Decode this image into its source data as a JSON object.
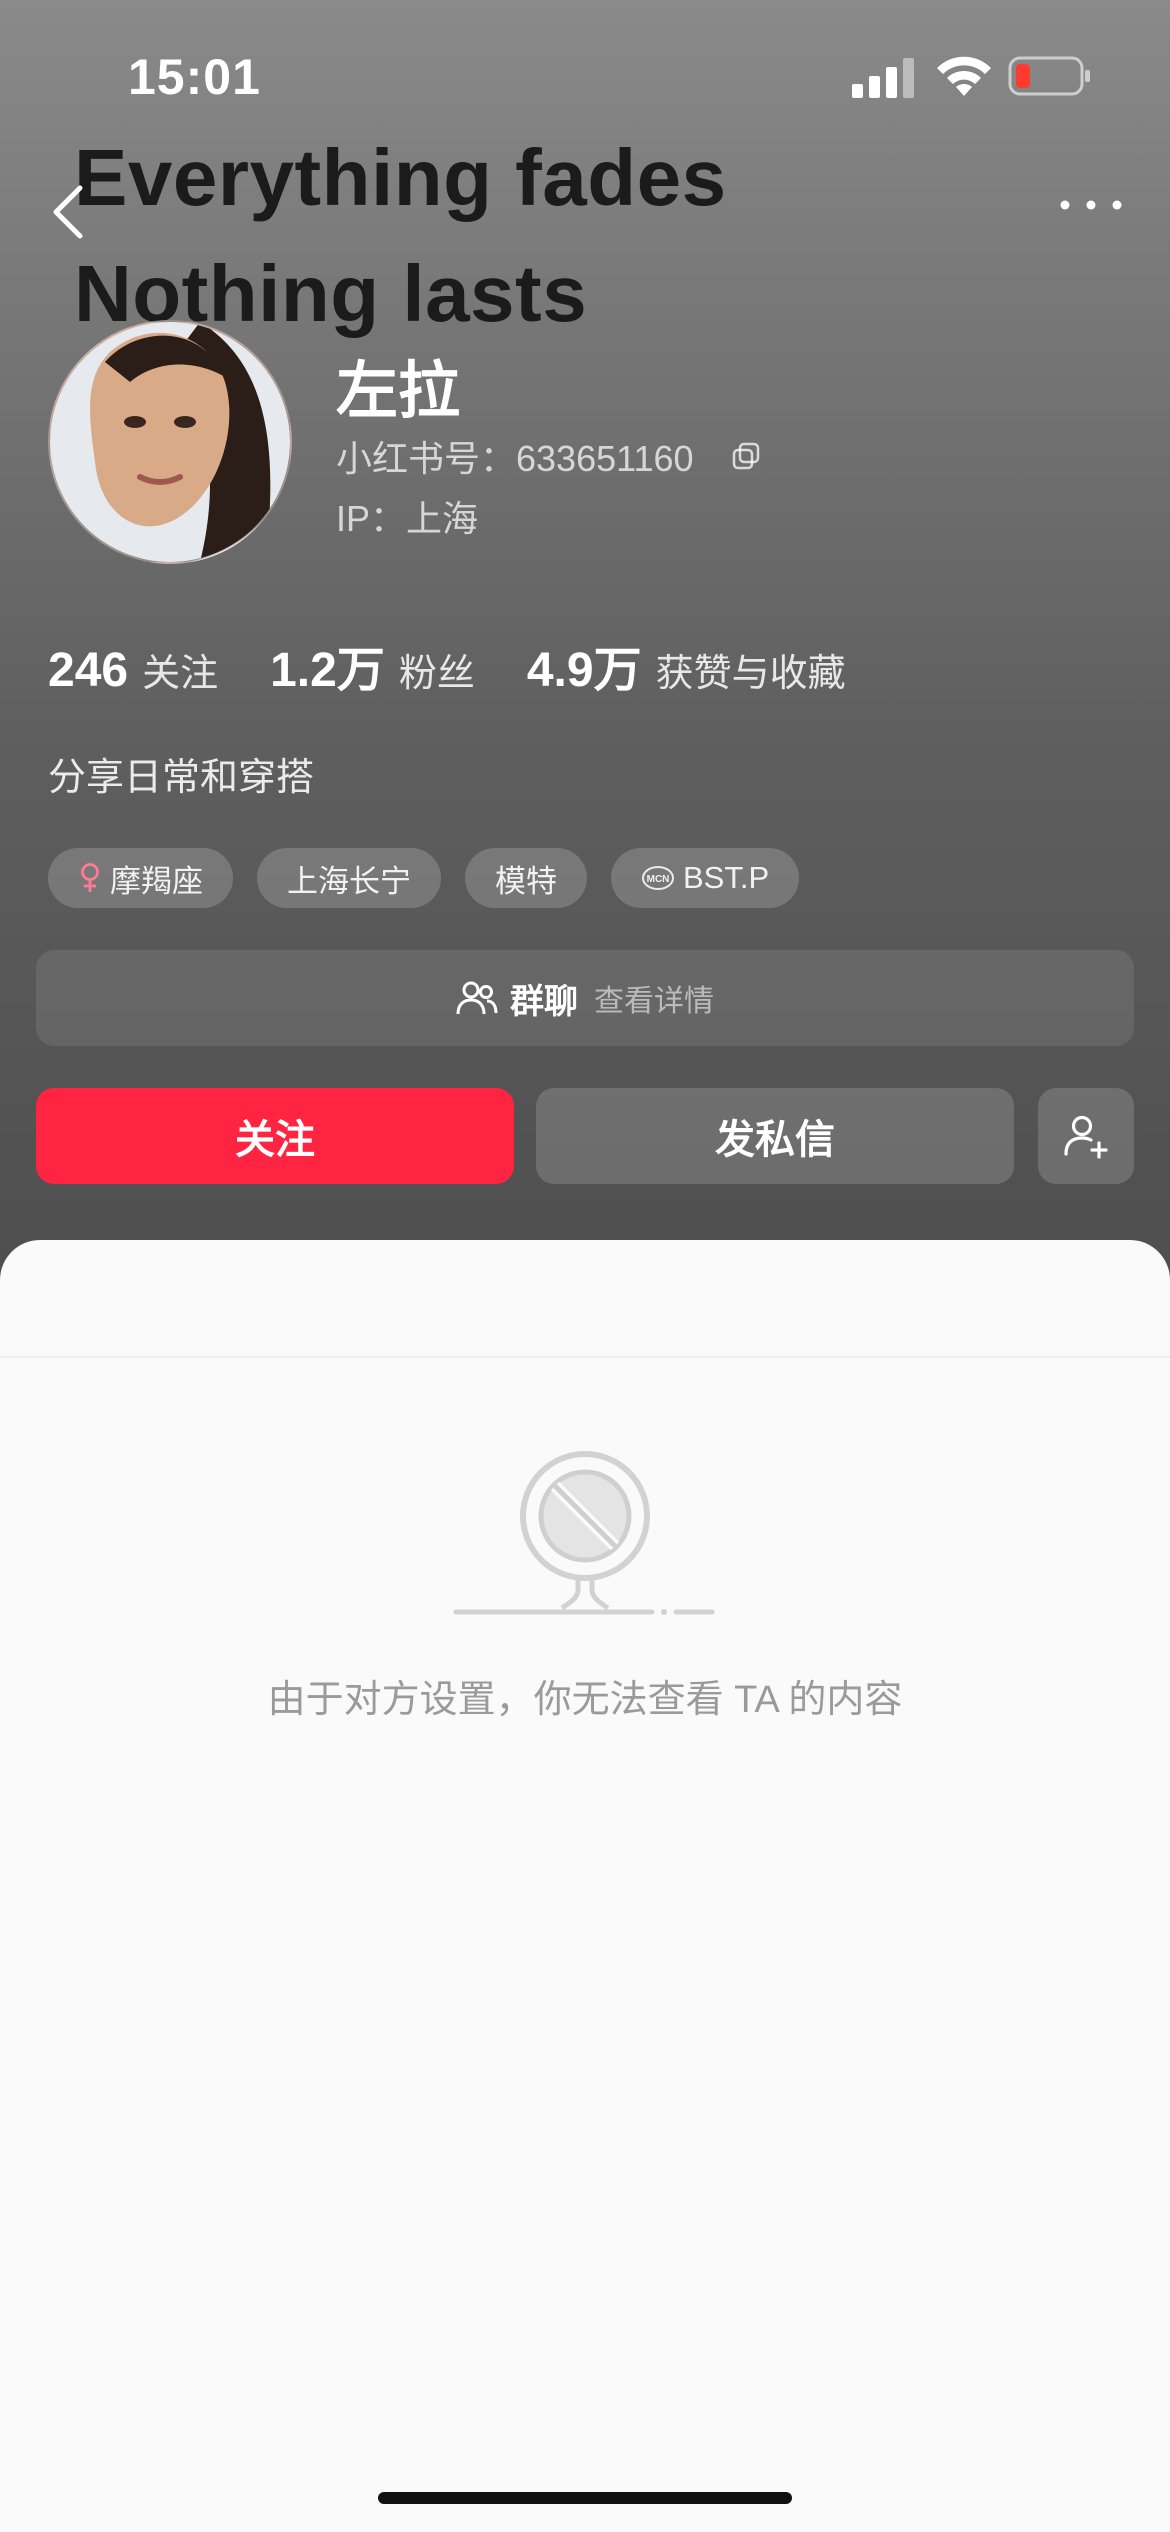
{
  "status_bar": {
    "time": "15:01",
    "signal_icon": "cellular-signal-icon",
    "wifi_icon": "wifi-icon",
    "battery_icon": "battery-low-icon",
    "battery_color": "#ff3b30"
  },
  "nav": {
    "back_icon": "chevron-left-icon",
    "more_icon": "more-horizontal-icon"
  },
  "cover_text": {
    "line1": "Everything fades",
    "line2": "Nothing lasts"
  },
  "profile": {
    "username": "左拉",
    "redid": "小红书号：633651160",
    "ip": "IP：上海",
    "bio": "分享日常和穿搭"
  },
  "stats": [
    {
      "value": "246",
      "label": "关注"
    },
    {
      "value": "1.2万",
      "label": "粉丝"
    },
    {
      "value": "4.9万",
      "label": "获赞与收藏"
    }
  ],
  "tags": [
    {
      "label": "摩羯座",
      "icon": "female-icon"
    },
    {
      "label": "上海长宁"
    },
    {
      "label": "模特"
    },
    {
      "label": "BST.P",
      "icon": "mcn-icon"
    }
  ],
  "group_chat": {
    "title": "群聊",
    "subtitle": "查看详情",
    "icon": "group-users-icon"
  },
  "actions": {
    "follow": "关注",
    "message": "发私信",
    "add_friend_icon": "add-user-icon"
  },
  "empty_state": {
    "icon": "blocked-content-icon",
    "text": "由于对方设置，你无法查看 TA 的内容"
  },
  "colors": {
    "accent": "#ff2442",
    "header_top": "#8a8a8a",
    "header_bottom": "#4d4d4d",
    "sheet_bg": "#fafafa"
  }
}
